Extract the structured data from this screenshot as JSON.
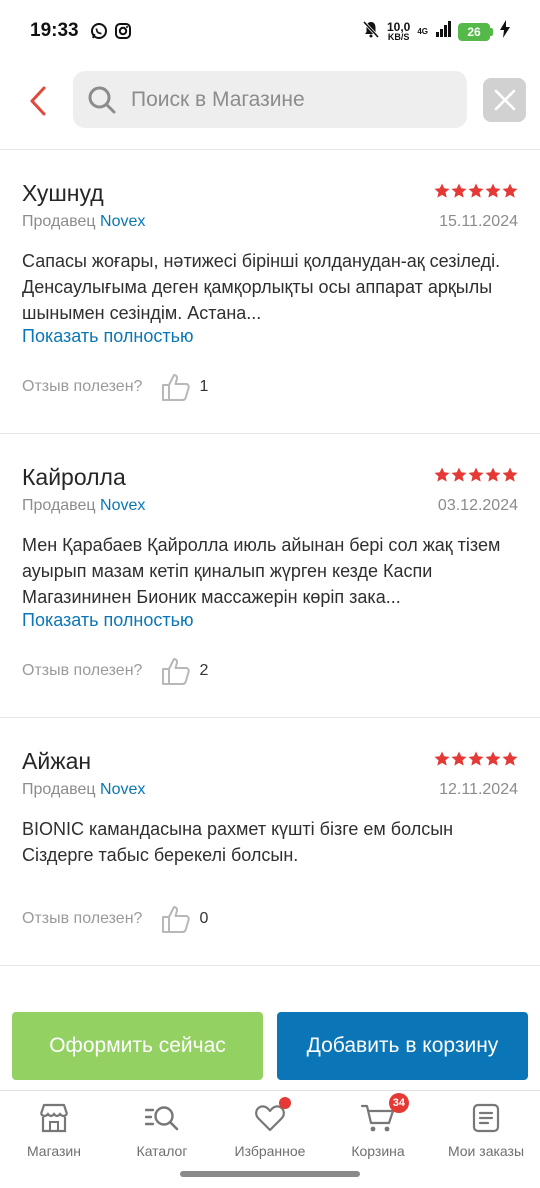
{
  "status_bar": {
    "time": "19:33",
    "speed_value": "10,0",
    "speed_unit": "KB/S",
    "network": "4G",
    "battery": "26",
    "app_icons": [
      "whatsapp-icon",
      "instagram-icon"
    ],
    "system_icons": [
      "mute-bell-icon",
      "signal-icon",
      "battery-icon",
      "charging-icon"
    ]
  },
  "search": {
    "placeholder": "Поиск в Магазине",
    "value": ""
  },
  "reviews": [
    {
      "author": "Хушнуд",
      "rating": 5,
      "seller_prefix": "Продавец",
      "seller_name": "Novex",
      "date": "15.11.2024",
      "text": "Сапасы жоғары, нәтижесі бірінші қолданудан-ақ сезіледі. Денсаулығыма деген қамқорлықты осы аппарат арқылы шынымен сезіндім. Астана...",
      "show_more": "Показать полностью",
      "helpful_label": "Отзыв полезен?",
      "helpful_count": "1"
    },
    {
      "author": "Кайролла",
      "rating": 5,
      "seller_prefix": "Продавец",
      "seller_name": "Novex",
      "date": "03.12.2024",
      "text": "Мен Қарабаев Қайролла июль айынан бері сол жақ тізем ауырып мазам кетіп қиналып жүрген кезде Каспи Магазининен Бионик массажерін көріп зака...",
      "show_more": "Показать полностью",
      "helpful_label": "Отзыв полезен?",
      "helpful_count": "2"
    },
    {
      "author": "Айжан",
      "rating": 5,
      "seller_prefix": "Продавец",
      "seller_name": "Novex",
      "date": "12.11.2024",
      "text": "BIONIC камандасына рахмет күшті бізге ем болсын Сіздерге табыс берекелі болсын.",
      "show_more": "",
      "helpful_label": "Отзыв полезен?",
      "helpful_count": "0"
    }
  ],
  "actions": {
    "order_now": "Оформить сейчас",
    "add_to_cart": "Добавить в корзину"
  },
  "tabbar": {
    "shop": "Магазин",
    "catalog": "Каталог",
    "favorites": "Избранное",
    "cart": "Корзина",
    "cart_badge": "34",
    "orders": "Мои заказы"
  },
  "colors": {
    "accent_blue": "#0a76b7",
    "accent_green": "#93d162",
    "star_red": "#e53935",
    "back_arrow": "#e0483e"
  }
}
